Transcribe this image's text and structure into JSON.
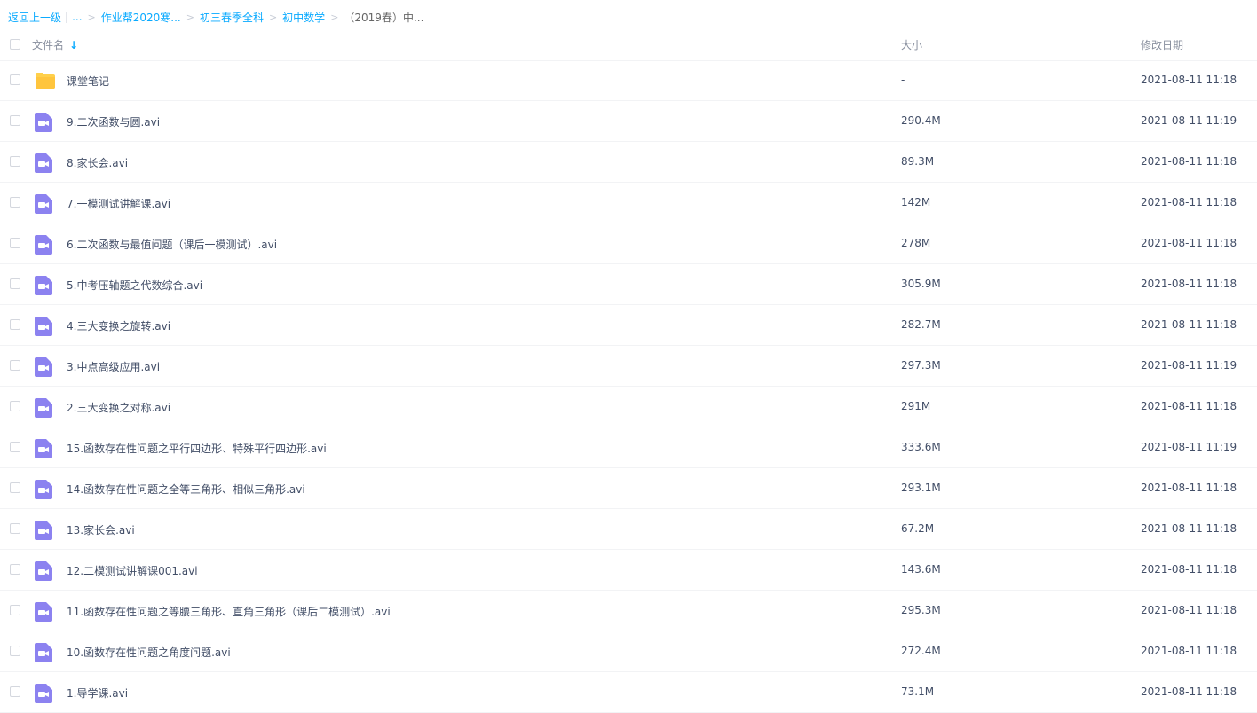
{
  "breadcrumb": {
    "back": "返回上一级",
    "sep": "|",
    "ellipsis": "...",
    "crumbs": [
      "作业帮2020寒...",
      "初三春季全科",
      "初中数学"
    ],
    "current": "（2019春）中..."
  },
  "header": {
    "name": "文件名",
    "sort_icon": "arrow-down-icon",
    "size": "大小",
    "date": "修改日期"
  },
  "colors": {
    "link": "#09aaff",
    "folder": "#ffd04b",
    "video": "#8c82f0"
  },
  "files": [
    {
      "type": "folder",
      "name": "课堂笔记",
      "size": "-",
      "date": "2021-08-11 11:18"
    },
    {
      "type": "video",
      "name": "9.二次函数与圆.avi",
      "size": "290.4M",
      "date": "2021-08-11 11:19"
    },
    {
      "type": "video",
      "name": "8.家长会.avi",
      "size": "89.3M",
      "date": "2021-08-11 11:18"
    },
    {
      "type": "video",
      "name": "7.一模测试讲解课.avi",
      "size": "142M",
      "date": "2021-08-11 11:18"
    },
    {
      "type": "video",
      "name": "6.二次函数与最值问题（课后一模测试）.avi",
      "size": "278M",
      "date": "2021-08-11 11:18"
    },
    {
      "type": "video",
      "name": "5.中考压轴题之代数综合.avi",
      "size": "305.9M",
      "date": "2021-08-11 11:18"
    },
    {
      "type": "video",
      "name": "4.三大变换之旋转.avi",
      "size": "282.7M",
      "date": "2021-08-11 11:18"
    },
    {
      "type": "video",
      "name": "3.中点高级应用.avi",
      "size": "297.3M",
      "date": "2021-08-11 11:19"
    },
    {
      "type": "video",
      "name": "2.三大变换之对称.avi",
      "size": "291M",
      "date": "2021-08-11 11:18"
    },
    {
      "type": "video",
      "name": "15.函数存在性问题之平行四边形、特殊平行四边形.avi",
      "size": "333.6M",
      "date": "2021-08-11 11:19"
    },
    {
      "type": "video",
      "name": "14.函数存在性问题之全等三角形、相似三角形.avi",
      "size": "293.1M",
      "date": "2021-08-11 11:18"
    },
    {
      "type": "video",
      "name": "13.家长会.avi",
      "size": "67.2M",
      "date": "2021-08-11 11:18"
    },
    {
      "type": "video",
      "name": "12.二模测试讲解课001.avi",
      "size": "143.6M",
      "date": "2021-08-11 11:18"
    },
    {
      "type": "video",
      "name": "11.函数存在性问题之等腰三角形、直角三角形（课后二模测试）.avi",
      "size": "295.3M",
      "date": "2021-08-11 11:18"
    },
    {
      "type": "video",
      "name": "10.函数存在性问题之角度问题.avi",
      "size": "272.4M",
      "date": "2021-08-11 11:18"
    },
    {
      "type": "video",
      "name": "1.导学课.avi",
      "size": "73.1M",
      "date": "2021-08-11 11:18"
    }
  ]
}
